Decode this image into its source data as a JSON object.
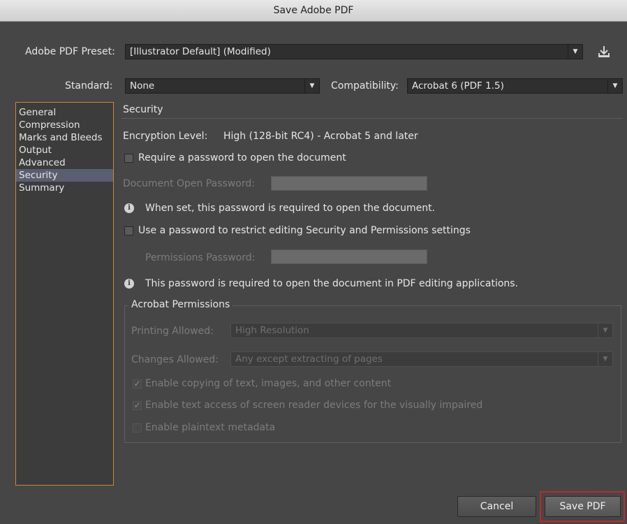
{
  "window": {
    "title": "Save Adobe PDF"
  },
  "preset": {
    "label": "Adobe PDF Preset:",
    "value": "[Illustrator Default] (Modified)"
  },
  "standard": {
    "label": "Standard:",
    "value": "None"
  },
  "compatibility": {
    "label": "Compatibility:",
    "value": "Acrobat 6 (PDF 1.5)"
  },
  "sidebar": {
    "items": [
      {
        "label": "General"
      },
      {
        "label": "Compression"
      },
      {
        "label": "Marks and Bleeds"
      },
      {
        "label": "Output"
      },
      {
        "label": "Advanced"
      },
      {
        "label": "Security"
      },
      {
        "label": "Summary"
      }
    ],
    "active": "Security"
  },
  "security": {
    "section_title": "Security",
    "encryption_label": "Encryption Level:",
    "encryption_value": "High (128-bit RC4) - Acrobat 5 and later",
    "require_open_password": "Require a password to open the document",
    "open_password_label": "Document Open Password:",
    "open_password_info": "When set, this password is required to open the document.",
    "restrict_editing": "Use a password to restrict editing Security and Permissions settings",
    "permissions_password_label": "Permissions Password:",
    "permissions_info": "This password is required to open the document in PDF editing applications."
  },
  "acrobat_permissions": {
    "title": "Acrobat Permissions",
    "printing_label": "Printing Allowed:",
    "printing_value": "High Resolution",
    "changes_label": "Changes Allowed:",
    "changes_value": "Any except extracting of pages",
    "copy_text": "Enable copying of text, images, and other content",
    "screen_reader": "Enable text access of screen reader devices for the visually impaired",
    "plaintext_metadata": "Enable plaintext metadata"
  },
  "buttons": {
    "cancel": "Cancel",
    "save": "Save PDF"
  },
  "colors": {
    "nav_border": "#d7822e",
    "save_highlight": "#c0282b",
    "active_nav": "#5b5e70"
  }
}
